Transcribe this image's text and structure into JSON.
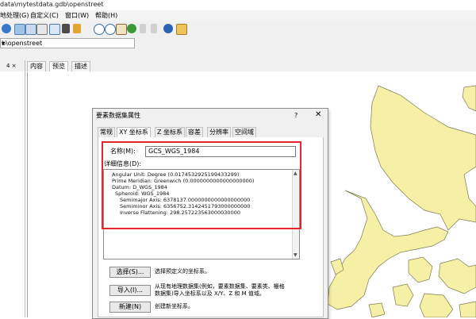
{
  "window": {
    "title": "data\\mytestdata.gdb\\openstreet"
  },
  "menu": {
    "items": [
      "地处理(G)",
      "自定义(C)",
      "窗口(W)",
      "帮助(H)"
    ]
  },
  "address": {
    "value": "b\\openstreet"
  },
  "left_pane": {
    "pin_label": "4 × "
  },
  "tabs": [
    "内容",
    "预览",
    "描述"
  ],
  "dialog": {
    "title": "要素数据集属性",
    "help": "?",
    "close": "✕",
    "tabs": [
      "常规",
      "XY 坐标系",
      "Z 坐标系",
      "容差",
      "分辨率",
      "空间域"
    ],
    "active_tab": 1,
    "name_label": "名称(M):",
    "name_value": "GCS_WGS_1984",
    "detail_label": "详细信息(D):",
    "details": [
      "Angular Unit: Degree (0.0174532925199433299)",
      "Prime Meridian: Greenwich (0.0000000000000000000)",
      "Datum: D_WGS_1984",
      "  Spheroid: WGS_1984",
      "    Semimajor Axis: 6378137.0000000000000000000",
      "    Semiminor Axis: 6356752.3142451793000000000",
      "    Inverse Flattening: 298.257223563000030000"
    ],
    "buttons": [
      {
        "label": "选择(S)...",
        "desc": [
          "选择预定义的坐标系。"
        ]
      },
      {
        "label": "导入(I)...",
        "desc": [
          "从现有地理数据集(例如，要素数据集、要素类、栅格",
          "数据集)导入坐标系以及 X/Y、Z 和 M 值域。"
        ]
      },
      {
        "label": "新建(N)",
        "desc": [
          "创建新坐标系。"
        ]
      }
    ]
  },
  "colors": {
    "map_fill": "#f6f0a6",
    "map_stroke": "#7a7a50",
    "highlight": "#e3262e"
  }
}
